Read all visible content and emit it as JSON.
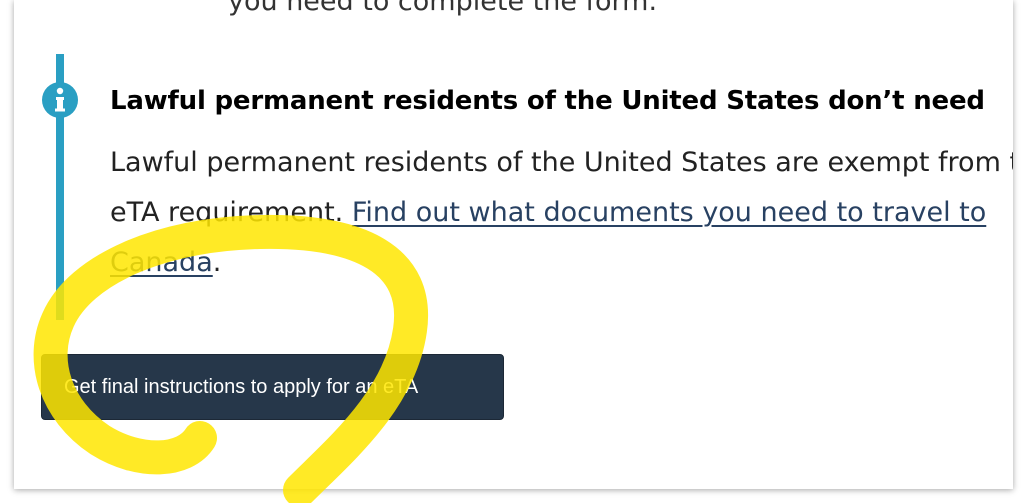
{
  "page": {
    "clipped_top_text": "you need to complete the form."
  },
  "alert": {
    "icon": "info-icon",
    "heading": "Lawful permanent residents of the United States don’t need",
    "body_prefix": "Lawful permanent residents of the United States are exempt from the eTA requirement. ",
    "link_text": "Find out what documents you need to travel to Canada",
    "body_suffix": "."
  },
  "cta": {
    "label": "Get final instructions to apply for an eTA"
  },
  "colors": {
    "alert_bar": "#2a9fc3",
    "link": "#284162",
    "button_bg": "#26374a",
    "highlight": "#ffe600"
  }
}
